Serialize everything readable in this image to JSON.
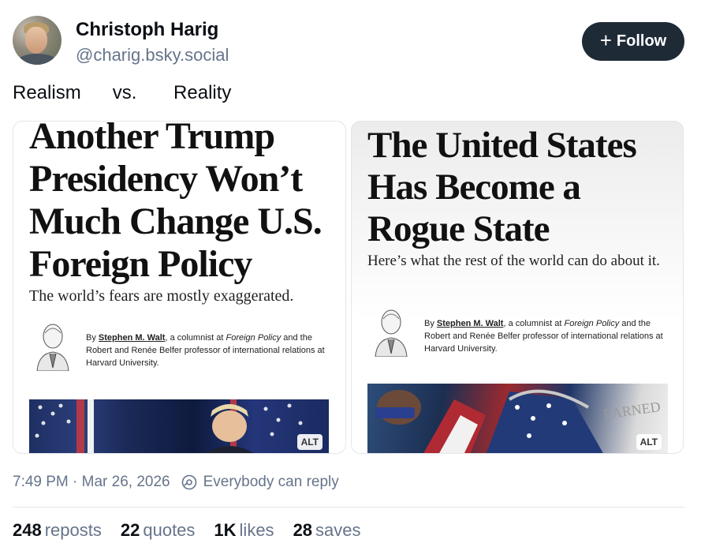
{
  "author": {
    "name": "Christoph Harig",
    "handle": "@charig.bsky.social"
  },
  "follow_button": {
    "label": "Follow"
  },
  "post": {
    "text": "Realism      vs.       Reality"
  },
  "images": [
    {
      "headline": "Another Trump Presidency Won’t Much Change U.S. Foreign Policy",
      "subhead": "The world’s fears are mostly exaggerated.",
      "byline_prefix": "By ",
      "byline_author": "Stephen M. Walt",
      "byline_mid": ", a columnist at ",
      "byline_pub": "Foreign Policy",
      "byline_rest": " and the Robert and Renée Belfer professor of international relations at Harvard University.",
      "alt_label": "ALT"
    },
    {
      "headline": "The United States Has Become a Rogue State",
      "subhead": "Here’s what the rest of the world can do about it.",
      "byline_prefix": "By ",
      "byline_author": "Stephen M. Walt",
      "byline_mid": ", a columnist at ",
      "byline_pub": "Foreign Policy",
      "byline_rest": " and the Robert and Renée Belfer professor of international relations at Harvard University.",
      "photo_text": "EARNED",
      "alt_label": "ALT"
    }
  ],
  "meta": {
    "timestamp": "7:49 PM · Mar 26, 2026",
    "reply_setting": "Everybody can reply"
  },
  "stats": {
    "reposts_count": "248",
    "reposts_label": "reposts",
    "quotes_count": "22",
    "quotes_label": "quotes",
    "likes_count": "1K",
    "likes_label": "likes",
    "saves_count": "28",
    "saves_label": "saves"
  },
  "colors": {
    "follow_bg": "#1f2a37",
    "muted_text": "#66748a",
    "primary_text": "#0b0f14"
  }
}
